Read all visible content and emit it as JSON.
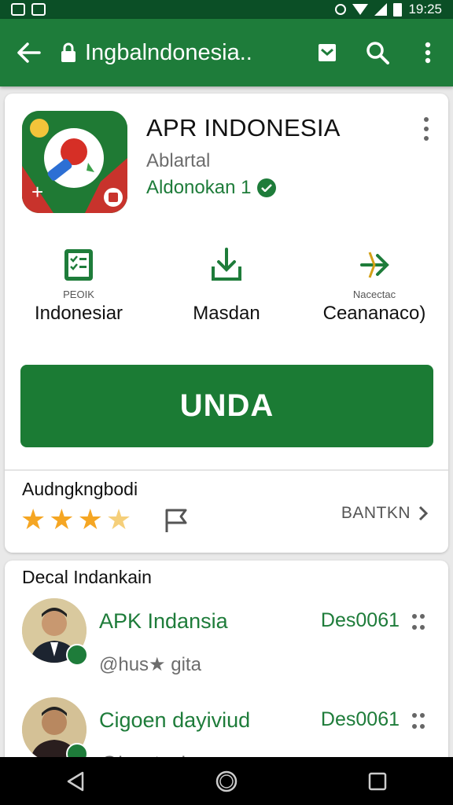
{
  "status_bar": {
    "time": "19:25"
  },
  "app_bar": {
    "title": "Ingbalndonesia..",
    "icons": [
      "back-arrow-icon",
      "lock-icon",
      "mail-icon",
      "search-icon",
      "more-vert-icon"
    ]
  },
  "app": {
    "name": "APR INDONESIA",
    "developer": "Ablartal",
    "category": "Aldonokan 1"
  },
  "stats": [
    {
      "small": "PEOIK",
      "big": "Indonesiar",
      "icon": "checklist-icon"
    },
    {
      "small": "",
      "big": "Masdan",
      "icon": "download-icon"
    },
    {
      "small": "Nacectac",
      "big": "Ceananaco)",
      "icon": "share-arrow-icon"
    }
  ],
  "install_button": {
    "label": "UNDA"
  },
  "rating": {
    "label": "Audngkngbodi",
    "stars": 3.5,
    "see_more": "BANTKN"
  },
  "reviews": {
    "title": "Decal Indankain",
    "items": [
      {
        "name": "APK Indansia",
        "sub": "@hus★ gita",
        "version": "Des0061"
      },
      {
        "name": "Cigoen dayiviud",
        "sub": "@hus★ gita",
        "version": "Des0061"
      }
    ]
  },
  "colors": {
    "primary": "#1e7c3a",
    "status_bar": "#0b4f26",
    "star": "#f5a623"
  }
}
